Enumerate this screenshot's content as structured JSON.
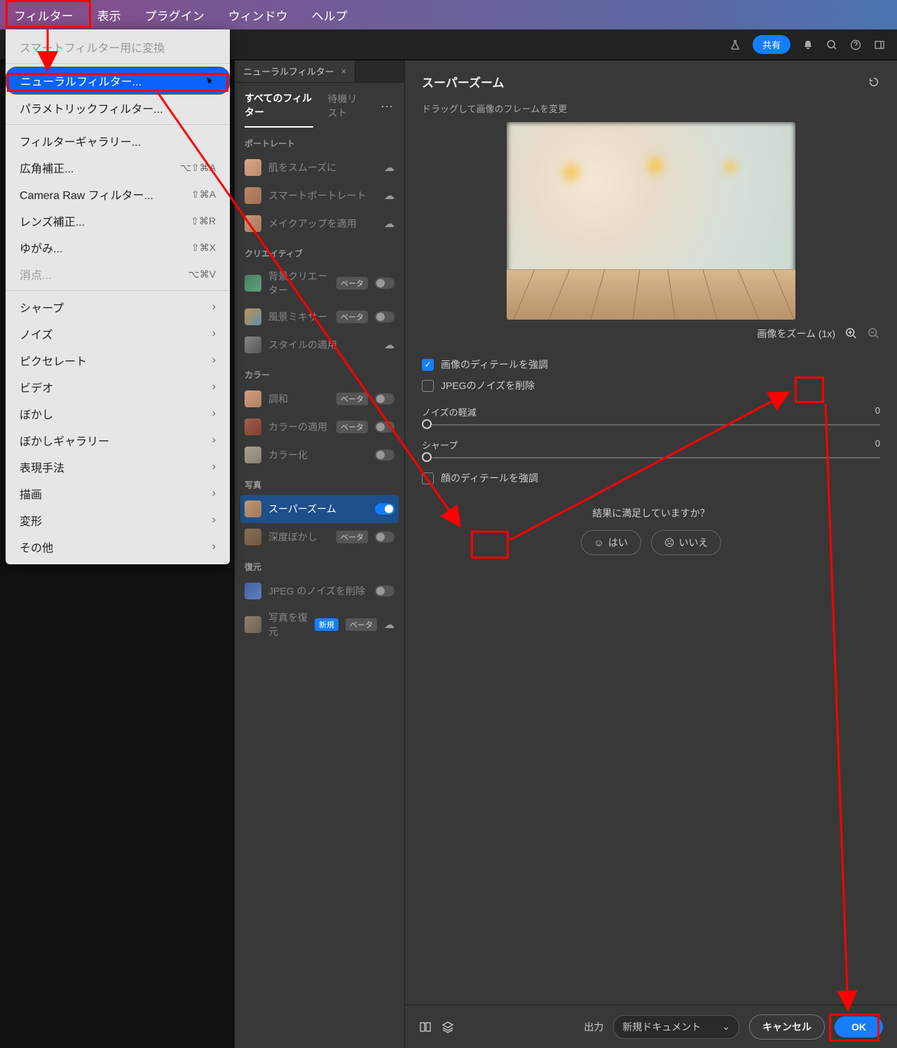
{
  "menubar": [
    "フィルター",
    "表示",
    "プラグイン",
    "ウィンドウ",
    "ヘルプ"
  ],
  "share": "共有",
  "tab_title": "ニューラルフィルター",
  "mid_tabs": {
    "all": "すべてのフィルター",
    "wait": "待機リスト"
  },
  "sections": {
    "portrait": "ポートレート",
    "creative": "クリエイティブ",
    "color": "カラー",
    "photo": "写真",
    "restore": "復元"
  },
  "items": {
    "skin": "肌をスムーズに",
    "smart": "スマートポートレート",
    "makeup": "メイクアップを適用",
    "bgcreate": "背景クリエーター",
    "landscape": "風景ミキサー",
    "style": "スタイルの適用",
    "harmony": "調和",
    "color_apply": "カラーの適用",
    "colorize": "カラー化",
    "superzoom": "スーパーズーム",
    "depth": "深度ぼかし",
    "jpeg_noise": "JPEG のノイズを削除",
    "restore_photo": "写真を復元"
  },
  "beta": "ベータ",
  "new": "新規",
  "panel": {
    "title": "スーパーズーム",
    "drag_hint": "ドラッグして画像のフレームを変更",
    "zoom_label": "画像をズーム (1x)",
    "enhance_detail": "画像のディテールを強調",
    "jpeg_remove": "JPEGのノイズを削除",
    "noise_reduce": "ノイズの軽減",
    "sharpen": "シャープ",
    "face_detail": "顔のディテールを強調",
    "noise_val": "0",
    "sharp_val": "0",
    "feedback_q": "結果に満足していますか？",
    "yes": "はい",
    "no": "いいえ"
  },
  "footer": {
    "output": "出力",
    "output_opt": "新規ドキュメント",
    "cancel": "キャンセル",
    "ok": "OK"
  },
  "menu": {
    "convert": "スマートフィルター用に変換",
    "neural": "ニューラルフィルター...",
    "parametric": "パラメトリックフィルター...",
    "gallery": "フィルターギャラリー...",
    "wide": "広角補正...",
    "raw": "Camera Raw フィルター...",
    "lens": "レンズ補正...",
    "liquify": "ゆがみ...",
    "vanish": "消点...",
    "sharp": "シャープ",
    "noise": "ノイズ",
    "pixelate": "ピクセレート",
    "video": "ビデオ",
    "blur": "ぼかし",
    "blurgal": "ぼかしギャラリー",
    "stylize": "表現手法",
    "sketch": "描画",
    "distort": "変形",
    "other": "その他",
    "k_wide": "⌥⇧⌘A",
    "k_raw": "⇧⌘A",
    "k_lens": "⇧⌘R",
    "k_liq": "⇧⌘X",
    "k_van": "⌥⌘V"
  }
}
